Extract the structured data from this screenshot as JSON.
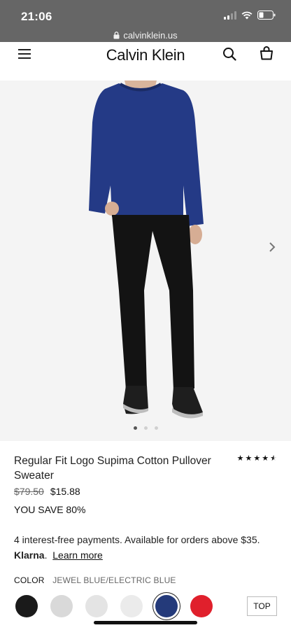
{
  "status_bar": {
    "time": "21:06"
  },
  "browser": {
    "url": "calvinklein.us"
  },
  "header": {
    "brand": "Calvin Klein",
    "icons": [
      "menu-icon",
      "search-icon",
      "bag-icon"
    ]
  },
  "gallery": {
    "image_count": 3,
    "active_index": 0,
    "colors": {
      "sweater": "#243a86",
      "pants": "#131313",
      "background": "#f4f4f4"
    }
  },
  "product": {
    "title": "Regular Fit Logo Supima Cotton Pullover Sweater",
    "rating_stars": 4.5,
    "rating_display": "★★★★★",
    "price_original": "$79.50",
    "price_sale": "$15.88",
    "savings": "YOU SAVE 80%"
  },
  "klarna": {
    "text": "4 interest-free payments. Available for orders above $35.",
    "brand": "Klarna",
    "link": "Learn more"
  },
  "color": {
    "label": "COLOR",
    "selected_name": "JEWEL BLUE/ELECTRIC BLUE",
    "swatches": [
      {
        "name": "black",
        "hex": "#1a1a1a"
      },
      {
        "name": "heather-grey",
        "hex": "#d9d9d9"
      },
      {
        "name": "light-grey",
        "hex": "#e4e4e4"
      },
      {
        "name": "pale-grey",
        "hex": "#ebebeb"
      },
      {
        "name": "jewel-blue",
        "hex": "#243a7a"
      },
      {
        "name": "red",
        "hex": "#e0202c"
      }
    ],
    "selected_index": 4
  },
  "top_button": "TOP"
}
